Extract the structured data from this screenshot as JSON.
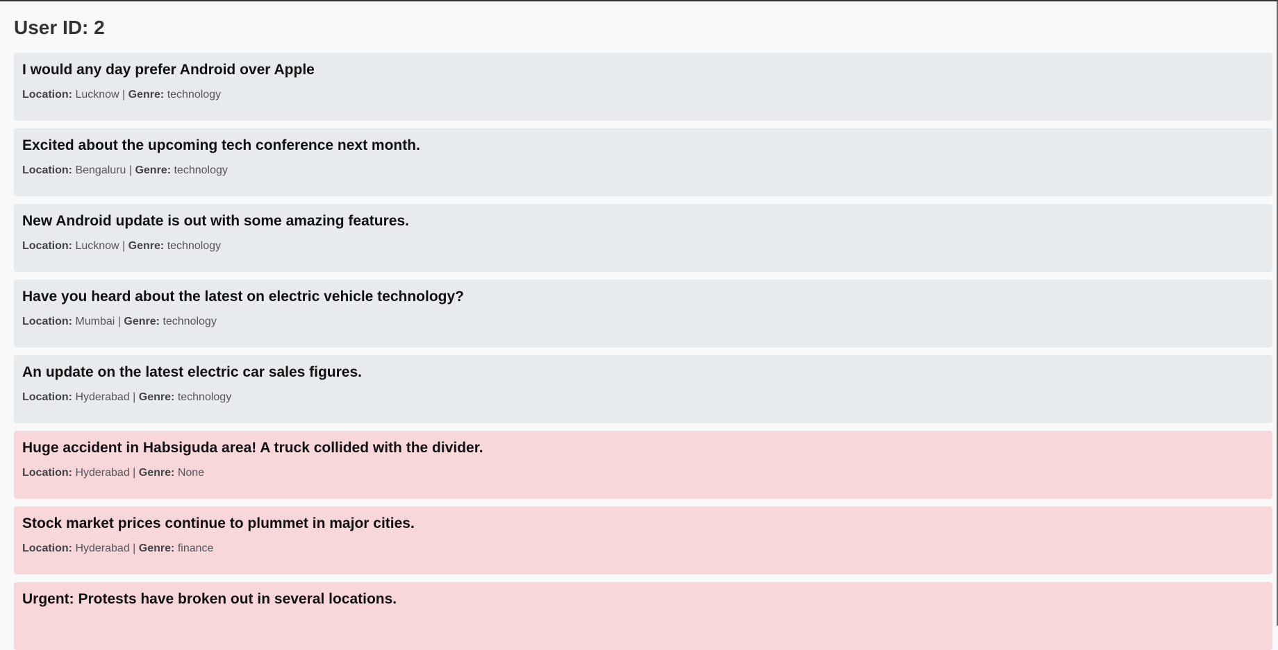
{
  "header": {
    "title": "User ID: 2"
  },
  "labels": {
    "location": "Location:",
    "genre": "Genre:",
    "separator": " | "
  },
  "posts": [
    {
      "title": "I would any day prefer Android over Apple",
      "location": "Lucknow",
      "genre": "technology",
      "highlight": "normal"
    },
    {
      "title": "Excited about the upcoming tech conference next month.",
      "location": "Bengaluru",
      "genre": "technology",
      "highlight": "normal"
    },
    {
      "title": "New Android update is out with some amazing features.",
      "location": "Lucknow",
      "genre": "technology",
      "highlight": "normal"
    },
    {
      "title": "Have you heard about the latest on electric vehicle technology?",
      "location": "Mumbai",
      "genre": "technology",
      "highlight": "normal"
    },
    {
      "title": "An update on the latest electric car sales figures.",
      "location": "Hyderabad",
      "genre": "technology",
      "highlight": "normal"
    },
    {
      "title": "Huge accident in Habsiguda area! A truck collided with the divider.",
      "location": "Hyderabad",
      "genre": "None",
      "highlight": "alert"
    },
    {
      "title": "Stock market prices continue to plummet in major cities.",
      "location": "Hyderabad",
      "genre": "finance",
      "highlight": "alert"
    },
    {
      "title": "Urgent: Protests have broken out in several locations.",
      "highlight": "alert"
    }
  ],
  "colors": {
    "normal_post_bg": "#e8ebee",
    "alert_post_bg": "#f7d7da",
    "page_bg": "#f9f9f9"
  }
}
